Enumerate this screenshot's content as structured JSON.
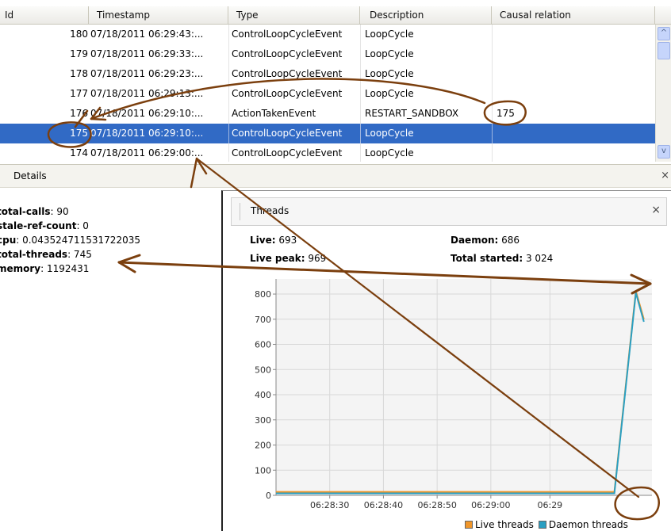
{
  "table": {
    "columns": [
      "Id",
      "Timestamp",
      "Type",
      "Description",
      "Causal relation"
    ],
    "rows": [
      {
        "id": "180",
        "timestamp": "07/18/2011 06:29:43:...",
        "type": "ControlLoopCycleEvent",
        "description": "LoopCycle",
        "causal": ""
      },
      {
        "id": "179",
        "timestamp": "07/18/2011 06:29:33:...",
        "type": "ControlLoopCycleEvent",
        "description": "LoopCycle",
        "causal": ""
      },
      {
        "id": "178",
        "timestamp": "07/18/2011 06:29:23:...",
        "type": "ControlLoopCycleEvent",
        "description": "LoopCycle",
        "causal": ""
      },
      {
        "id": "177",
        "timestamp": "07/18/2011 06:29:13:...",
        "type": "ControlLoopCycleEvent",
        "description": "LoopCycle",
        "causal": ""
      },
      {
        "id": "176",
        "timestamp": "07/18/2011 06:29:10:...",
        "type": "ActionTakenEvent",
        "description": "RESTART_SANDBOX",
        "causal": "175"
      },
      {
        "id": "175",
        "timestamp": "07/18/2011 06:29:10:...",
        "type": "ControlLoopCycleEvent",
        "description": "LoopCycle",
        "causal": "",
        "selected": true
      },
      {
        "id": "174",
        "timestamp": "07/18/2011 06:29:00:...",
        "type": "ControlLoopCycleEvent",
        "description": "LoopCycle",
        "causal": ""
      }
    ],
    "scroll_up_glyph": "^",
    "scroll_down_glyph": "v"
  },
  "details": {
    "title": "Details",
    "close": "×",
    "metrics": [
      {
        "key": "total-calls",
        "value": ": 90"
      },
      {
        "key": "stale-ref-count",
        "value": ": 0"
      },
      {
        "key": "cpu",
        "value": ": 0.043524711531722035"
      },
      {
        "key": "total-threads",
        "value": ": 745"
      },
      {
        "key": "memory",
        "value": ": 1192431"
      }
    ]
  },
  "threads": {
    "title": "Threads",
    "close": "×",
    "live_label": "Live:",
    "live_value": "693",
    "daemon_label": "Daemon:",
    "daemon_value": "686",
    "live_peak_label": "Live peak:",
    "live_peak_value": "969",
    "total_started_label": "Total started:",
    "total_started_value": "3 024"
  },
  "chart_data": {
    "type": "line",
    "x_tick_labels": [
      "06:28:30",
      "06:28:40",
      "06:28:50",
      "06:29:00",
      "06:29"
    ],
    "y_tick_labels": [
      "0",
      "100",
      "200",
      "300",
      "400",
      "500",
      "600",
      "700",
      "800"
    ],
    "ylim": [
      0,
      860
    ],
    "xlim_seconds": [
      0,
      70
    ],
    "grid": true,
    "legend_position": "bottom-right",
    "series": [
      {
        "name": "Live threads",
        "color": "#f0962a",
        "points": [
          [
            0,
            14
          ],
          [
            10,
            14
          ],
          [
            20,
            14
          ],
          [
            30,
            14
          ],
          [
            40,
            14
          ],
          [
            50,
            14
          ],
          [
            63,
            14
          ],
          [
            67,
            812
          ],
          [
            68.5,
            700
          ]
        ]
      },
      {
        "name": "Daemon threads",
        "color": "#2a9fc2",
        "points": [
          [
            0,
            8
          ],
          [
            10,
            8
          ],
          [
            20,
            8
          ],
          [
            30,
            8
          ],
          [
            40,
            8
          ],
          [
            50,
            8
          ],
          [
            63,
            8
          ],
          [
            67,
            805
          ],
          [
            68.5,
            690
          ]
        ]
      }
    ]
  },
  "annotation_color": "#7b3f0e"
}
